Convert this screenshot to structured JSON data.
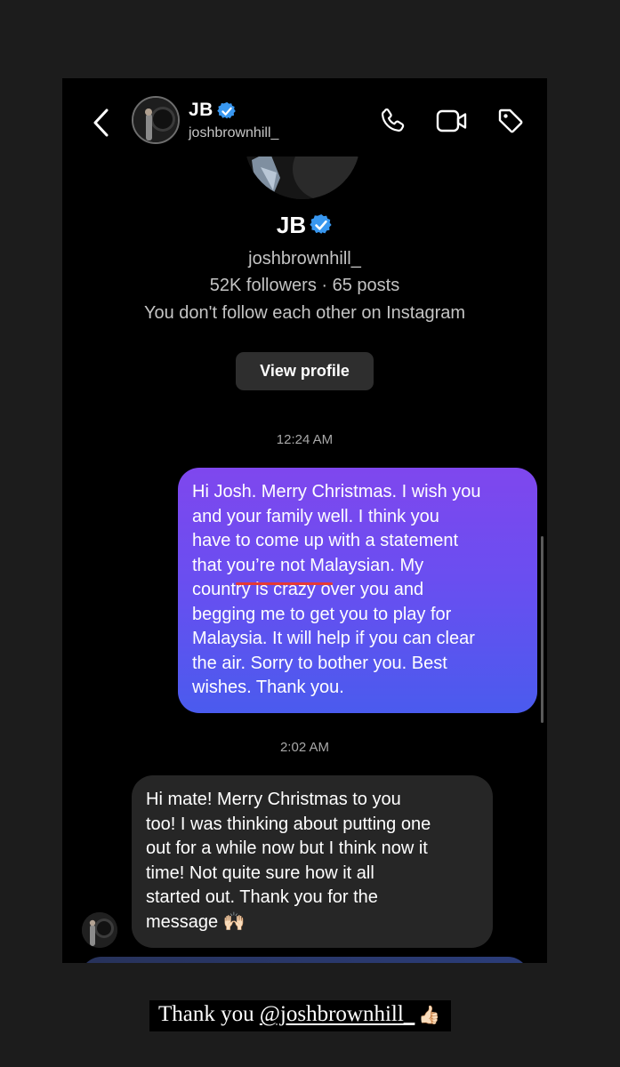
{
  "header": {
    "name": "JB",
    "handle": "joshbrownhill_",
    "back_icon": "chevron-left-icon",
    "actions": [
      "phone-icon",
      "video-camera-icon",
      "tag-icon"
    ]
  },
  "profile": {
    "name": "JB",
    "verified": true,
    "handle": "joshbrownhill_",
    "stats": "52K followers · 65 posts",
    "follow_status": "You don't follow each other on Instagram",
    "view_profile_label": "View profile"
  },
  "messages": [
    {
      "time": "12:24 AM",
      "direction": "sent",
      "lines": [
        "Hi Josh. Merry Christmas. I wish you",
        "and your family well. I think you",
        "have to come up with a statement",
        "that you’re not Malaysian. My",
        "country is crazy over you and",
        "begging me to get you to play for",
        "Malaysia. It will help if you can clear",
        "the air. Sorry to bother you. Best",
        "wishes. Thank you."
      ]
    },
    {
      "time": "2:02 AM",
      "direction": "received",
      "lines": [
        "Hi mate! Merry Christmas to you",
        "too! I was thinking about putting one",
        "out for a while now but I think now it",
        "time! Not quite sure how it all",
        "started out. Thank you for the",
        "message 🙌🏻"
      ]
    }
  ],
  "caption": {
    "text": "Thank you ",
    "mention": "@joshbrownhill_",
    "emoji": "👍🏻"
  },
  "colors": {
    "verified_badge": "#3897f0",
    "sent_bubble_top": "#7f47ee",
    "sent_bubble_bottom": "#4a5bee",
    "received_bubble": "#262626",
    "highlight_underline": "#e53935"
  }
}
